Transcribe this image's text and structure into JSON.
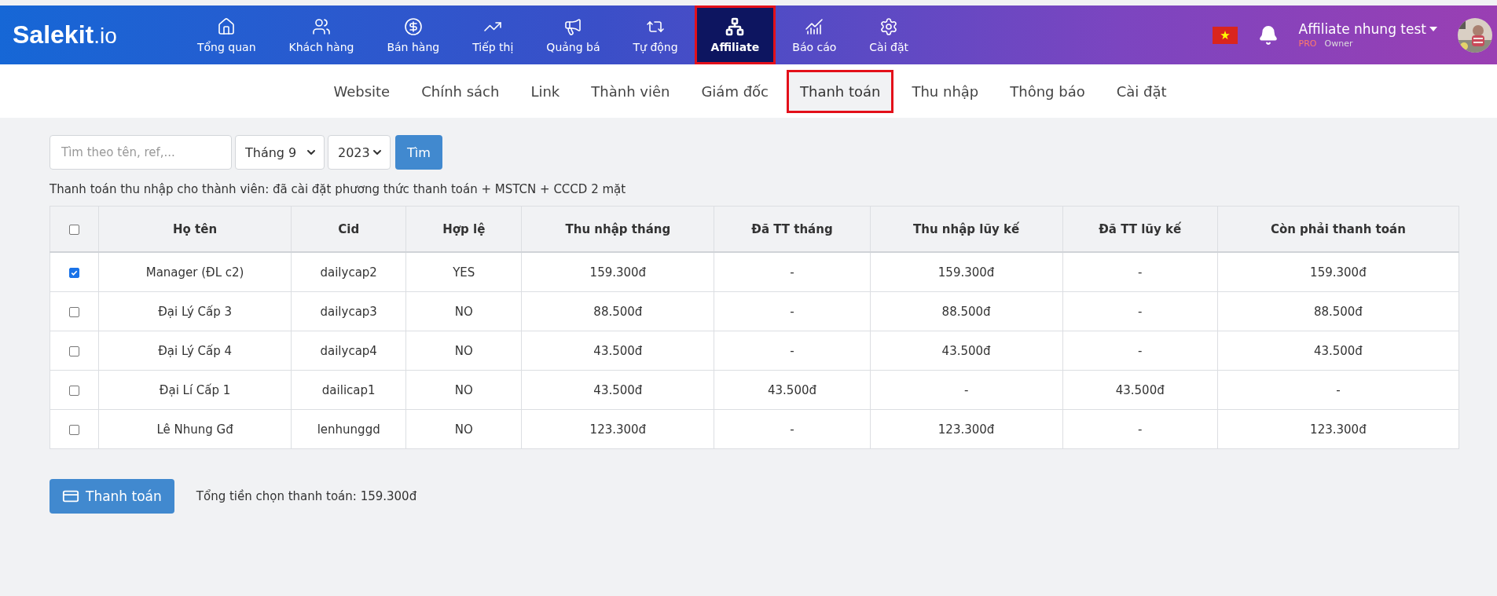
{
  "logo": {
    "main": "Salekit",
    "suffix": ".io"
  },
  "nav": [
    {
      "label": "Tổng quan",
      "selected": false,
      "highlighted": false
    },
    {
      "label": "Khách hàng",
      "selected": false,
      "highlighted": false
    },
    {
      "label": "Bán hàng",
      "selected": false,
      "highlighted": false
    },
    {
      "label": "Tiếp thị",
      "selected": false,
      "highlighted": false
    },
    {
      "label": "Quảng bá",
      "selected": false,
      "highlighted": false
    },
    {
      "label": "Tự động",
      "selected": false,
      "highlighted": false
    },
    {
      "label": "Affiliate",
      "selected": true,
      "highlighted": true
    },
    {
      "label": "Báo cáo",
      "selected": false,
      "highlighted": false
    },
    {
      "label": "Cài đặt",
      "selected": false,
      "highlighted": false
    }
  ],
  "user": {
    "name": "Affiliate nhung test",
    "plan": "PRO",
    "role": "Owner"
  },
  "subnav": [
    {
      "label": "Website",
      "selected": false,
      "highlighted": false
    },
    {
      "label": "Chính sách",
      "selected": false,
      "highlighted": false
    },
    {
      "label": "Link",
      "selected": false,
      "highlighted": false
    },
    {
      "label": "Thành viên",
      "selected": false,
      "highlighted": false
    },
    {
      "label": "Giám đốc",
      "selected": false,
      "highlighted": false
    },
    {
      "label": "Thanh toán",
      "selected": true,
      "highlighted": true
    },
    {
      "label": "Thu nhập",
      "selected": false,
      "highlighted": false
    },
    {
      "label": "Thông báo",
      "selected": false,
      "highlighted": false
    },
    {
      "label": "Cài đặt",
      "selected": false,
      "highlighted": false
    }
  ],
  "filters": {
    "search": {
      "placeholder": "Tìm theo tên, ref,..."
    },
    "month": "Tháng 9",
    "year": "2023",
    "button": "Tìm"
  },
  "note": "Thanh toán thu nhập cho thành viên: đã cài đặt phương thức thanh toán + MSTCN + CCCD 2 mặt",
  "table": {
    "select_all": {
      "checked": false
    },
    "columns": [
      "Họ tên",
      "Cid",
      "Hợp lệ",
      "Thu nhập tháng",
      "Đã TT tháng",
      "Thu nhập lũy kế",
      "Đã TT lũy kế",
      "Còn phải thanh toán"
    ],
    "rows": [
      {
        "checked": true,
        "cells": [
          "Manager (ĐL c2)",
          "dailycap2",
          "YES",
          "159.300đ",
          "-",
          "159.300đ",
          "-",
          "159.300đ"
        ]
      },
      {
        "checked": false,
        "cells": [
          "Đại Lý Cấp 3",
          "dailycap3",
          "NO",
          "88.500đ",
          "-",
          "88.500đ",
          "-",
          "88.500đ"
        ]
      },
      {
        "checked": false,
        "cells": [
          "Đại Lý Cấp 4",
          "dailycap4",
          "NO",
          "43.500đ",
          "-",
          "43.500đ",
          "-",
          "43.500đ"
        ]
      },
      {
        "checked": false,
        "cells": [
          "Đại Lí Cấp 1",
          "dailicap1",
          "NO",
          "43.500đ",
          "43.500đ",
          "-",
          "43.500đ",
          "-"
        ]
      },
      {
        "checked": false,
        "cells": [
          "Lê Nhung Gđ",
          "lenhunggd",
          "NO",
          "123.300đ",
          "-",
          "123.300đ",
          "-",
          "123.300đ"
        ]
      }
    ]
  },
  "pay_button": "Thanh toán",
  "total": "Tổng tiền chọn thanh toán: 159.300đ"
}
